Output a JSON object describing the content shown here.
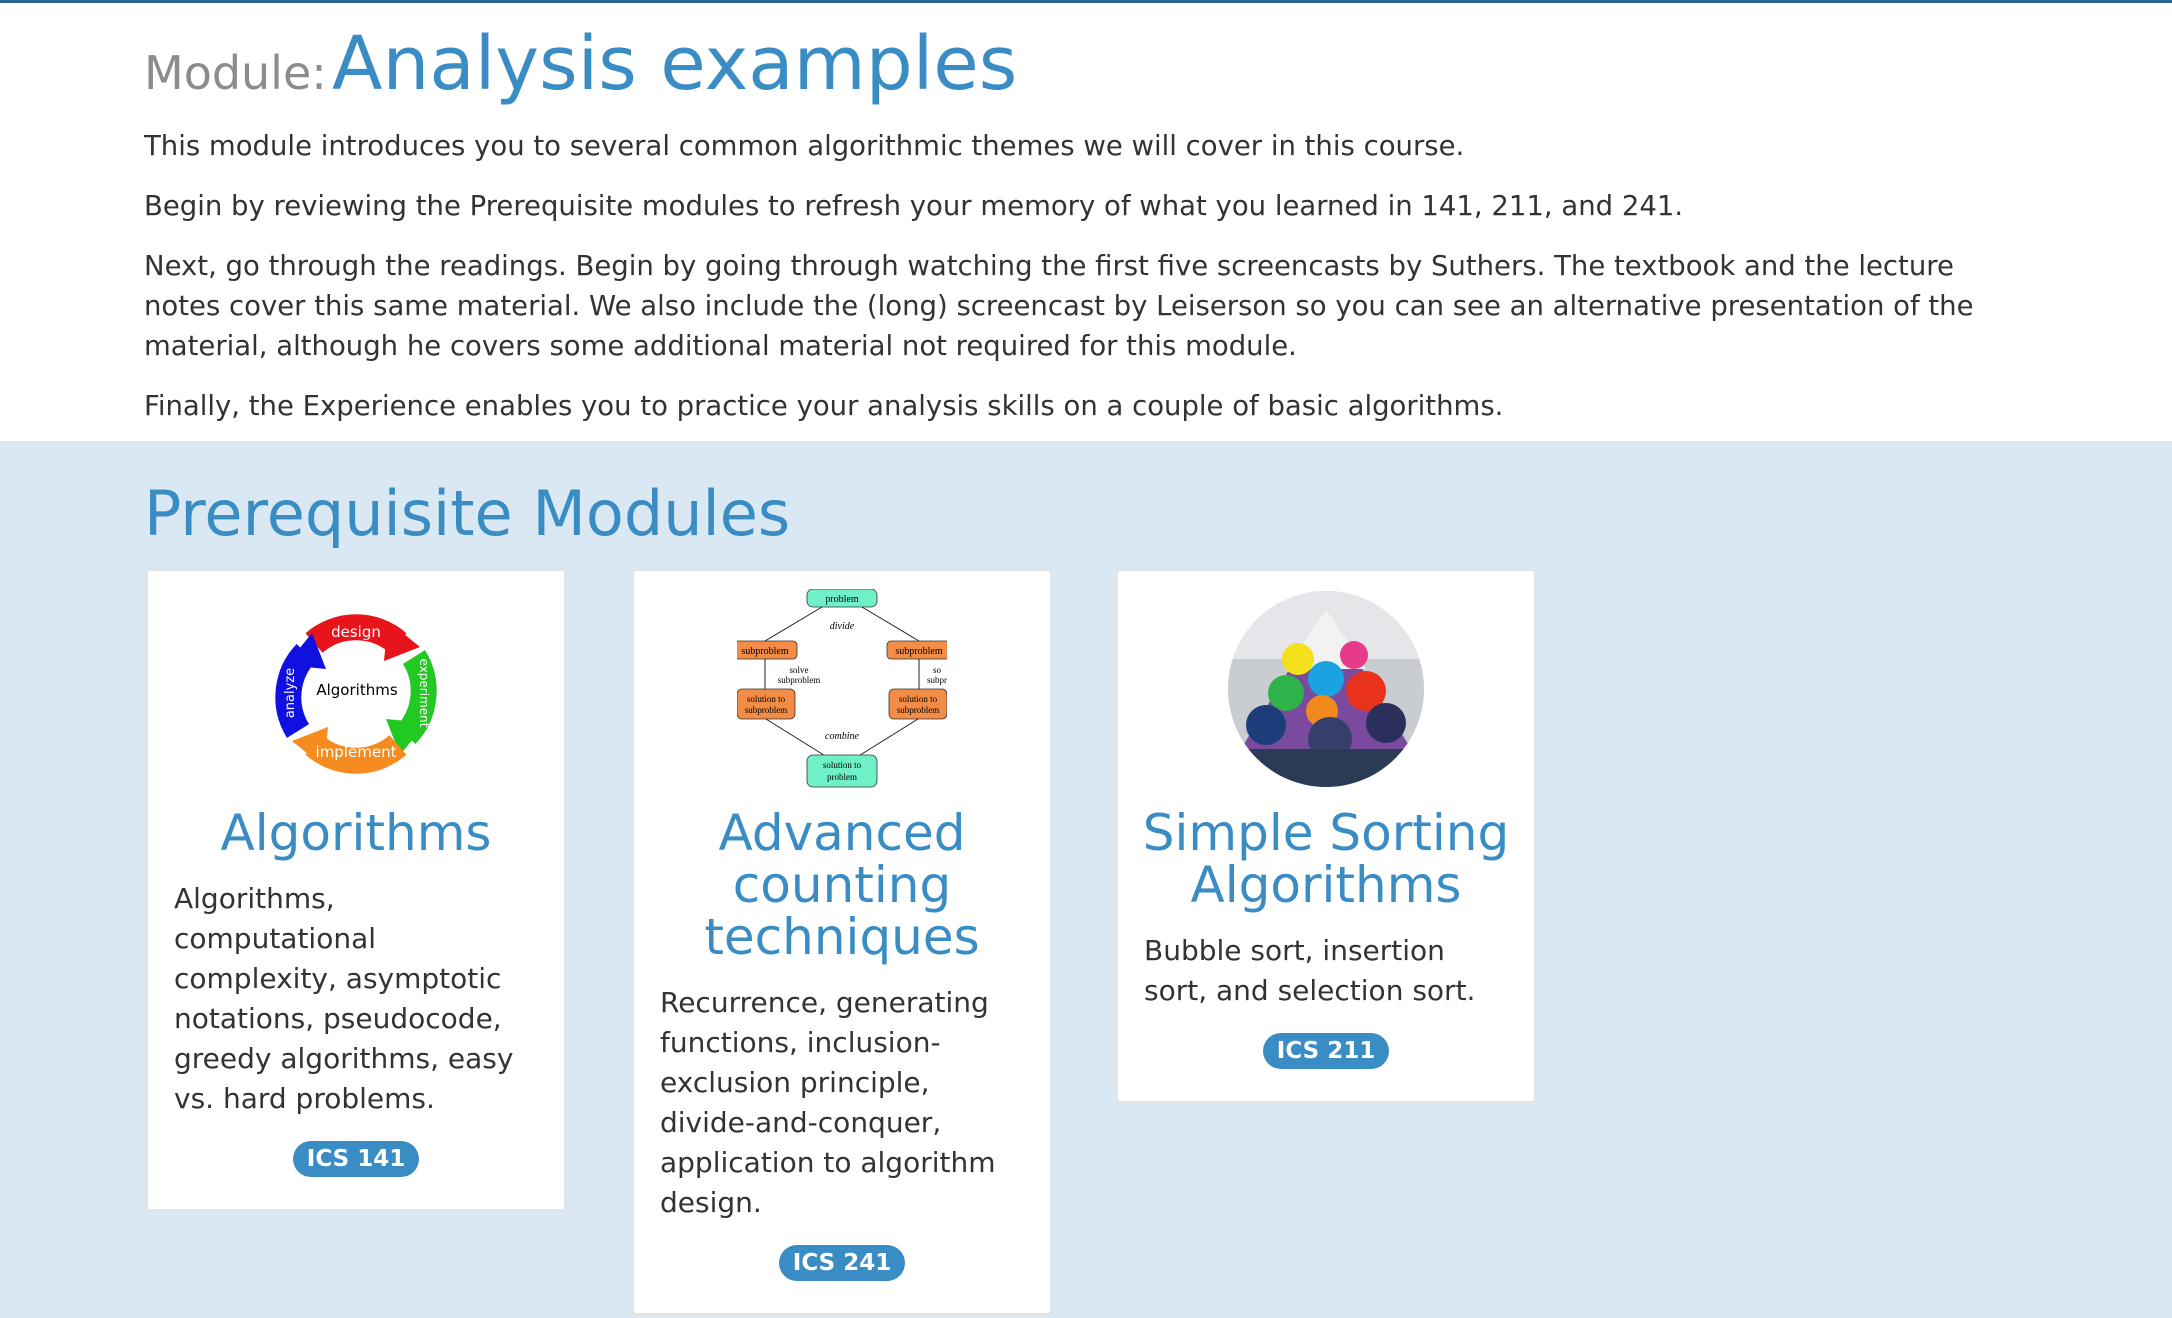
{
  "module": {
    "prefix": "Module:",
    "title": "Analysis examples",
    "paragraphs": [
      "This module introduces you to several common algorithmic themes we will cover in this course.",
      "Begin by reviewing the Prerequisite modules to refresh your memory of what you learned in 141, 211, and 241.",
      "Next, go through the readings. Begin by going through watching the first five screencasts by Suthers. The textbook and the lecture notes cover this same material. We also include the (long) screencast by Leiserson so you can see an alternative presentation of the material, although he covers some additional material not required for this module.",
      "Finally, the Experience enables you to practice your analysis skills on a couple of basic algorithms."
    ]
  },
  "prerequisites": {
    "heading": "Prerequisite Modules",
    "cards": [
      {
        "title": "Algorithms",
        "description": "Algorithms, computational complexity, asymptotic notations, pseudocode, greedy algorithms, easy vs. hard problems.",
        "badge": "ICS 141",
        "image_labels": {
          "top": "design",
          "right": "experiment",
          "bottom": "implement",
          "left": "analyze",
          "center": "Algorithms"
        }
      },
      {
        "title": "Advanced counting techniques",
        "description": "Recurrence, generating functions, inclusion-exclusion principle, divide-and-conquer, application to algorithm design.",
        "badge": "ICS 241",
        "image_labels": {
          "problem": "problem",
          "divide": "divide",
          "subproblem_left": "subproblem",
          "subproblem_right": "subproblem",
          "solve1": "solve",
          "solve2": "subproblem",
          "solve_right1": "so",
          "solve_right2": "subpr",
          "solution_left1": "solution to",
          "solution_left2": "subproblem",
          "solution_right1": "solution to",
          "solution_right2": "subproblem",
          "combine": "combine",
          "final1": "solution to",
          "final2": "problem"
        }
      },
      {
        "title": "Simple Sorting Algorithms",
        "description": "Bubble sort, insertion sort, and selection sort.",
        "badge": "ICS 211"
      }
    ]
  },
  "colors": {
    "accent": "#3a8cc4",
    "section_bg": "#d9e8f3",
    "muted": "#8c8c8c"
  }
}
